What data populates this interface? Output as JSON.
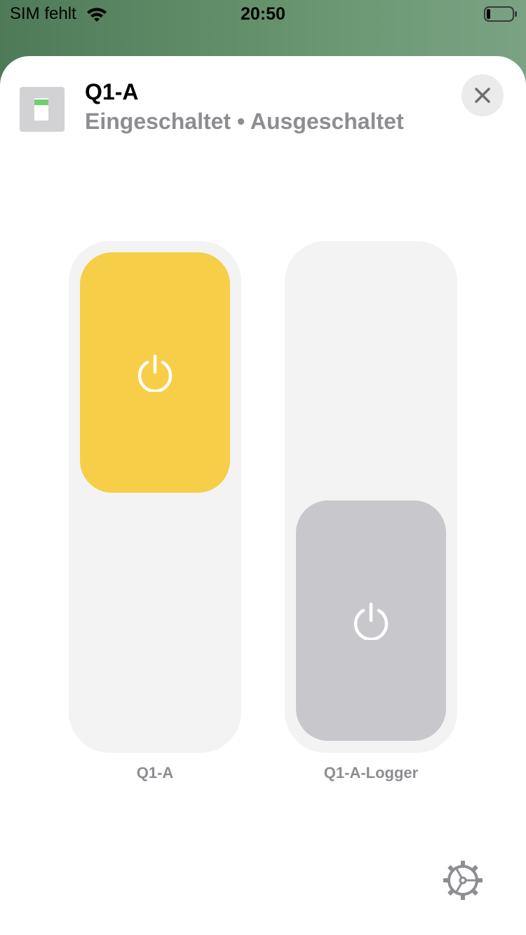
{
  "status_bar": {
    "carrier": "SIM fehlt",
    "time": "20:50",
    "battery_level": 0.15
  },
  "header": {
    "title": "Q1-A",
    "subtitle": "Eingeschaltet • Ausgeschaltet",
    "icon": "light-switch-icon",
    "close_icon": "close-icon"
  },
  "switches": [
    {
      "label": "Q1-A",
      "state": "on",
      "color": "#f6ce48",
      "icon": "power-icon"
    },
    {
      "label": "Q1-A-Logger",
      "state": "off",
      "color": "#c8c8cc",
      "icon": "power-icon"
    }
  ],
  "footer": {
    "settings_icon": "gear-icon"
  },
  "colors": {
    "on": "#f6ce48",
    "off": "#c8c8cc",
    "track": "#f3f3f4",
    "secondary_text": "#8d8d92"
  }
}
